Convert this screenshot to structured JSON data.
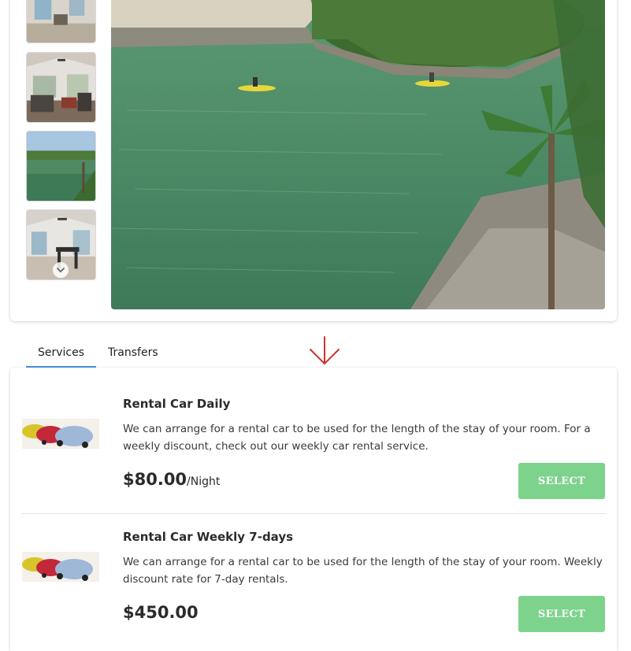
{
  "gallery": {
    "thumbnails": [
      {
        "name": "living-room"
      },
      {
        "name": "bedroom-sitting-area"
      },
      {
        "name": "lagoon-view"
      },
      {
        "name": "dining-area"
      }
    ],
    "more_icon": "chevron-down-icon",
    "main_photo": "lagoon-kayakers"
  },
  "tabs": [
    {
      "label": "Services",
      "active": true
    },
    {
      "label": "Transfers",
      "active": false
    }
  ],
  "annotation": {
    "icon": "arrow-down-icon",
    "color": "#d03030"
  },
  "services": [
    {
      "title": "Rental Car Daily",
      "description": "We can arrange for a rental car to be used for the length of the stay of your room. For a weekly discount, check out our weekly car rental service.",
      "price": "$80.00",
      "unit": "/Night",
      "button": "SELECT"
    },
    {
      "title": "Rental Car Weekly 7-days",
      "description": "We can arrange for a rental car to be used for the length of the stay of your room. Weekly discount rate for 7-day rentals.",
      "price": "$450.00",
      "unit": "",
      "button": "SELECT"
    }
  ],
  "colors": {
    "tab_underline": "#4a90d9",
    "select_button": "#7dd38c",
    "arrow": "#d03030"
  }
}
